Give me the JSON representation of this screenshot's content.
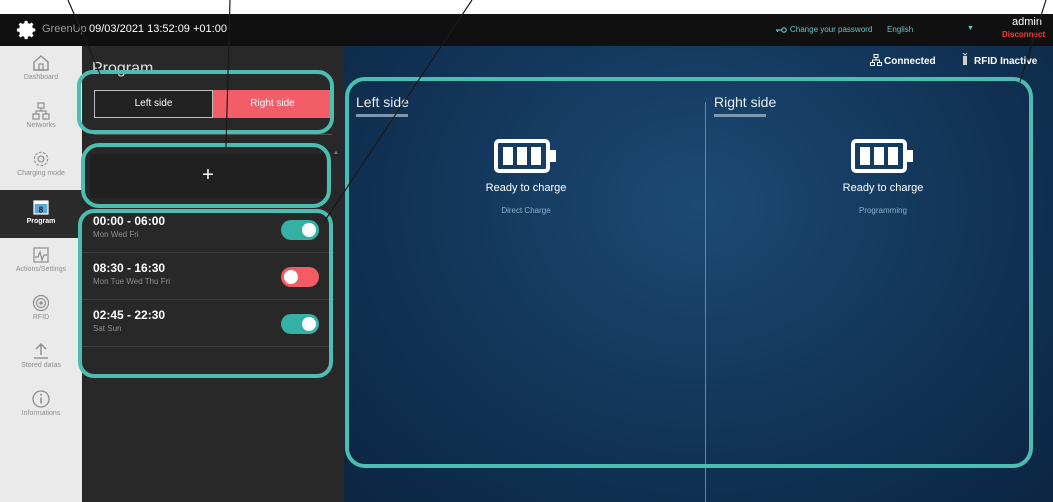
{
  "topbar": {
    "brand": "GreenUp",
    "datetime": "09/03/2021 13:52:09 +01:00",
    "change_password": "Change your password",
    "language": "English",
    "user": "admin",
    "disconnect": "Disconnect"
  },
  "nav": {
    "items": [
      {
        "label": "Dashboard",
        "icon": "home-icon"
      },
      {
        "label": "Networks",
        "icon": "network-icon"
      },
      {
        "label": "Charging mode",
        "icon": "gear-icon"
      },
      {
        "label": "Program",
        "icon": "calendar-icon",
        "active": true
      },
      {
        "label": "Actions/Settings",
        "icon": "chart-icon"
      },
      {
        "label": "RFID",
        "icon": "rfid-icon"
      },
      {
        "label": "Stored datas",
        "icon": "upload-icon"
      },
      {
        "label": "Informations",
        "icon": "info-icon"
      }
    ]
  },
  "program": {
    "title": "Program",
    "tabs": {
      "left": "Left side",
      "right": "Right side",
      "selected": "right"
    },
    "add_label": "+",
    "schedules": [
      {
        "time": "00:00 - 06:00",
        "days": "Mon Wed Fri",
        "enabled": true
      },
      {
        "time": "08:30 - 16:30",
        "days": "Mon Tue Wed Thu Fri",
        "enabled": false
      },
      {
        "time": "02:45 - 22:30",
        "days": "Sat Sun",
        "enabled": true
      }
    ]
  },
  "status": {
    "connection": "Connected",
    "rfid": "RFID Inactive"
  },
  "sides": {
    "left": {
      "title": "Left side",
      "state": "Ready to charge",
      "mode": "Direct Charge"
    },
    "right": {
      "title": "Right side",
      "state": "Ready to charge",
      "mode": "Programming"
    }
  },
  "colors": {
    "accent_teal": "#34b0a5",
    "accent_red": "#f25d68",
    "annotation": "#4cbdb1",
    "main_bg": "#123457"
  }
}
